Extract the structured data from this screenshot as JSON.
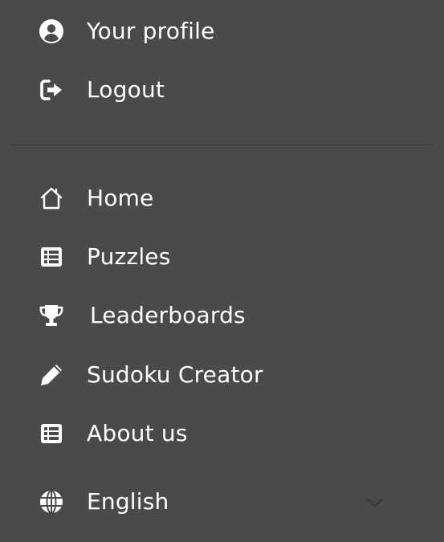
{
  "account": {
    "items": [
      {
        "label": "Your profile",
        "icon": "user-circle-icon"
      },
      {
        "label": "Logout",
        "icon": "logout-icon"
      }
    ]
  },
  "nav": {
    "items": [
      {
        "label": "Home",
        "icon": "home-icon"
      },
      {
        "label": "Puzzles",
        "icon": "table-list-icon"
      },
      {
        "label": "Leaderboards",
        "icon": "trophy-icon"
      },
      {
        "label": "Sudoku Creator",
        "icon": "pencil-icon"
      },
      {
        "label": "About us",
        "icon": "table-list-icon"
      }
    ]
  },
  "language": {
    "selected": "English",
    "icon": "globe-icon",
    "dropdown_icon": "chevron-down-icon"
  },
  "colors": {
    "background": "#4a4a4a",
    "text": "#ffffff",
    "divider": "#3a3a3a",
    "chevron": "#3a3a3a"
  }
}
